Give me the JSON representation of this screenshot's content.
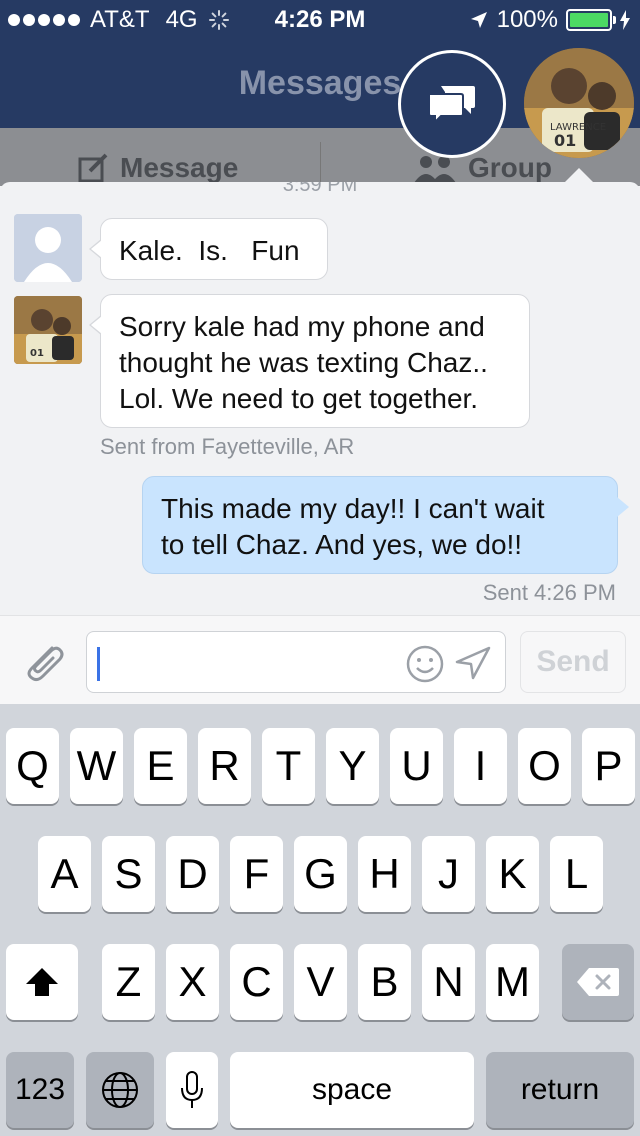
{
  "status_bar": {
    "carrier": "AT&T",
    "network": "4G",
    "time": "4:26 PM",
    "battery": "100%"
  },
  "nav": {
    "title": "Messages"
  },
  "subbar": {
    "message_label": "Message",
    "group_label": "Group"
  },
  "chat": {
    "timestamp": "3:59 PM",
    "messages": [
      {
        "direction": "incoming",
        "text_lines": [
          "Kale.  Is.   Fun"
        ]
      },
      {
        "direction": "incoming",
        "text_lines": [
          "Sorry kale had my phone and",
          "thought he was texting Chaz..",
          "Lol. We need to get together."
        ],
        "meta": "Sent from Fayetteville, AR"
      },
      {
        "direction": "outgoing",
        "text_lines": [
          "This made my day!! I can't wait",
          "to tell Chaz. And yes, we do!!"
        ],
        "meta": "Sent 4:26 PM"
      }
    ]
  },
  "composer": {
    "send_label": "Send",
    "input_value": ""
  },
  "keyboard": {
    "row1": [
      "Q",
      "W",
      "E",
      "R",
      "T",
      "Y",
      "U",
      "I",
      "O",
      "P"
    ],
    "row2": [
      "A",
      "S",
      "D",
      "F",
      "G",
      "H",
      "J",
      "K",
      "L"
    ],
    "row3": [
      "Z",
      "X",
      "C",
      "V",
      "B",
      "N",
      "M"
    ],
    "numbers_label": "123",
    "space_label": "space",
    "return_label": "return"
  },
  "colors": {
    "nav_bg": "#263a63",
    "outgoing_bubble": "#c9e4fe",
    "battery": "#4cd964"
  },
  "icons": [
    "location-arrow-icon",
    "chat-bubbles-icon",
    "compose-icon",
    "group-icon",
    "paperclip-icon",
    "smiley-icon",
    "send-arrow-icon",
    "shift-icon",
    "backspace-icon",
    "globe-icon",
    "microphone-icon"
  ]
}
